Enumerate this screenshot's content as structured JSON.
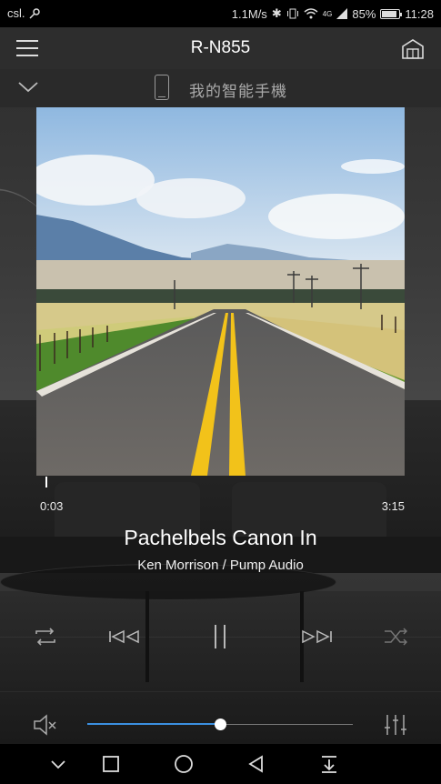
{
  "status_bar": {
    "carrier": "csl.",
    "net_speed": "1.1M/s",
    "signal_label": "4G",
    "battery": "85%",
    "battery_level": 0.85,
    "time": "11:28"
  },
  "app_bar": {
    "title": "R-N855"
  },
  "source": {
    "name": "我的智能手機"
  },
  "playback": {
    "elapsed": "0:03",
    "total": "3:15",
    "progress": 0.015,
    "title": "Pachelbels Canon In",
    "artist": "Ken Morrison / Pump Audio"
  },
  "volume": {
    "level": 0.5
  },
  "colors": {
    "accent": "#3b8fe0",
    "appbar": "#2d2d2d",
    "road_line": "#f2c21a"
  },
  "icons": {
    "menu": "menu-icon",
    "home": "home-icon",
    "collapse": "chevron-down-icon",
    "source": "phone-icon",
    "repeat": "repeat-icon",
    "prev": "skip-previous-icon",
    "pause": "pause-icon",
    "next": "skip-next-icon",
    "shuffle": "shuffle-icon",
    "mute": "mute-icon",
    "equalizer": "equalizer-icon",
    "nav_hide": "chevron-down-icon",
    "nav_recent": "square-icon",
    "nav_home": "circle-icon",
    "nav_back": "triangle-back-icon",
    "nav_notif": "pull-down-icon"
  }
}
